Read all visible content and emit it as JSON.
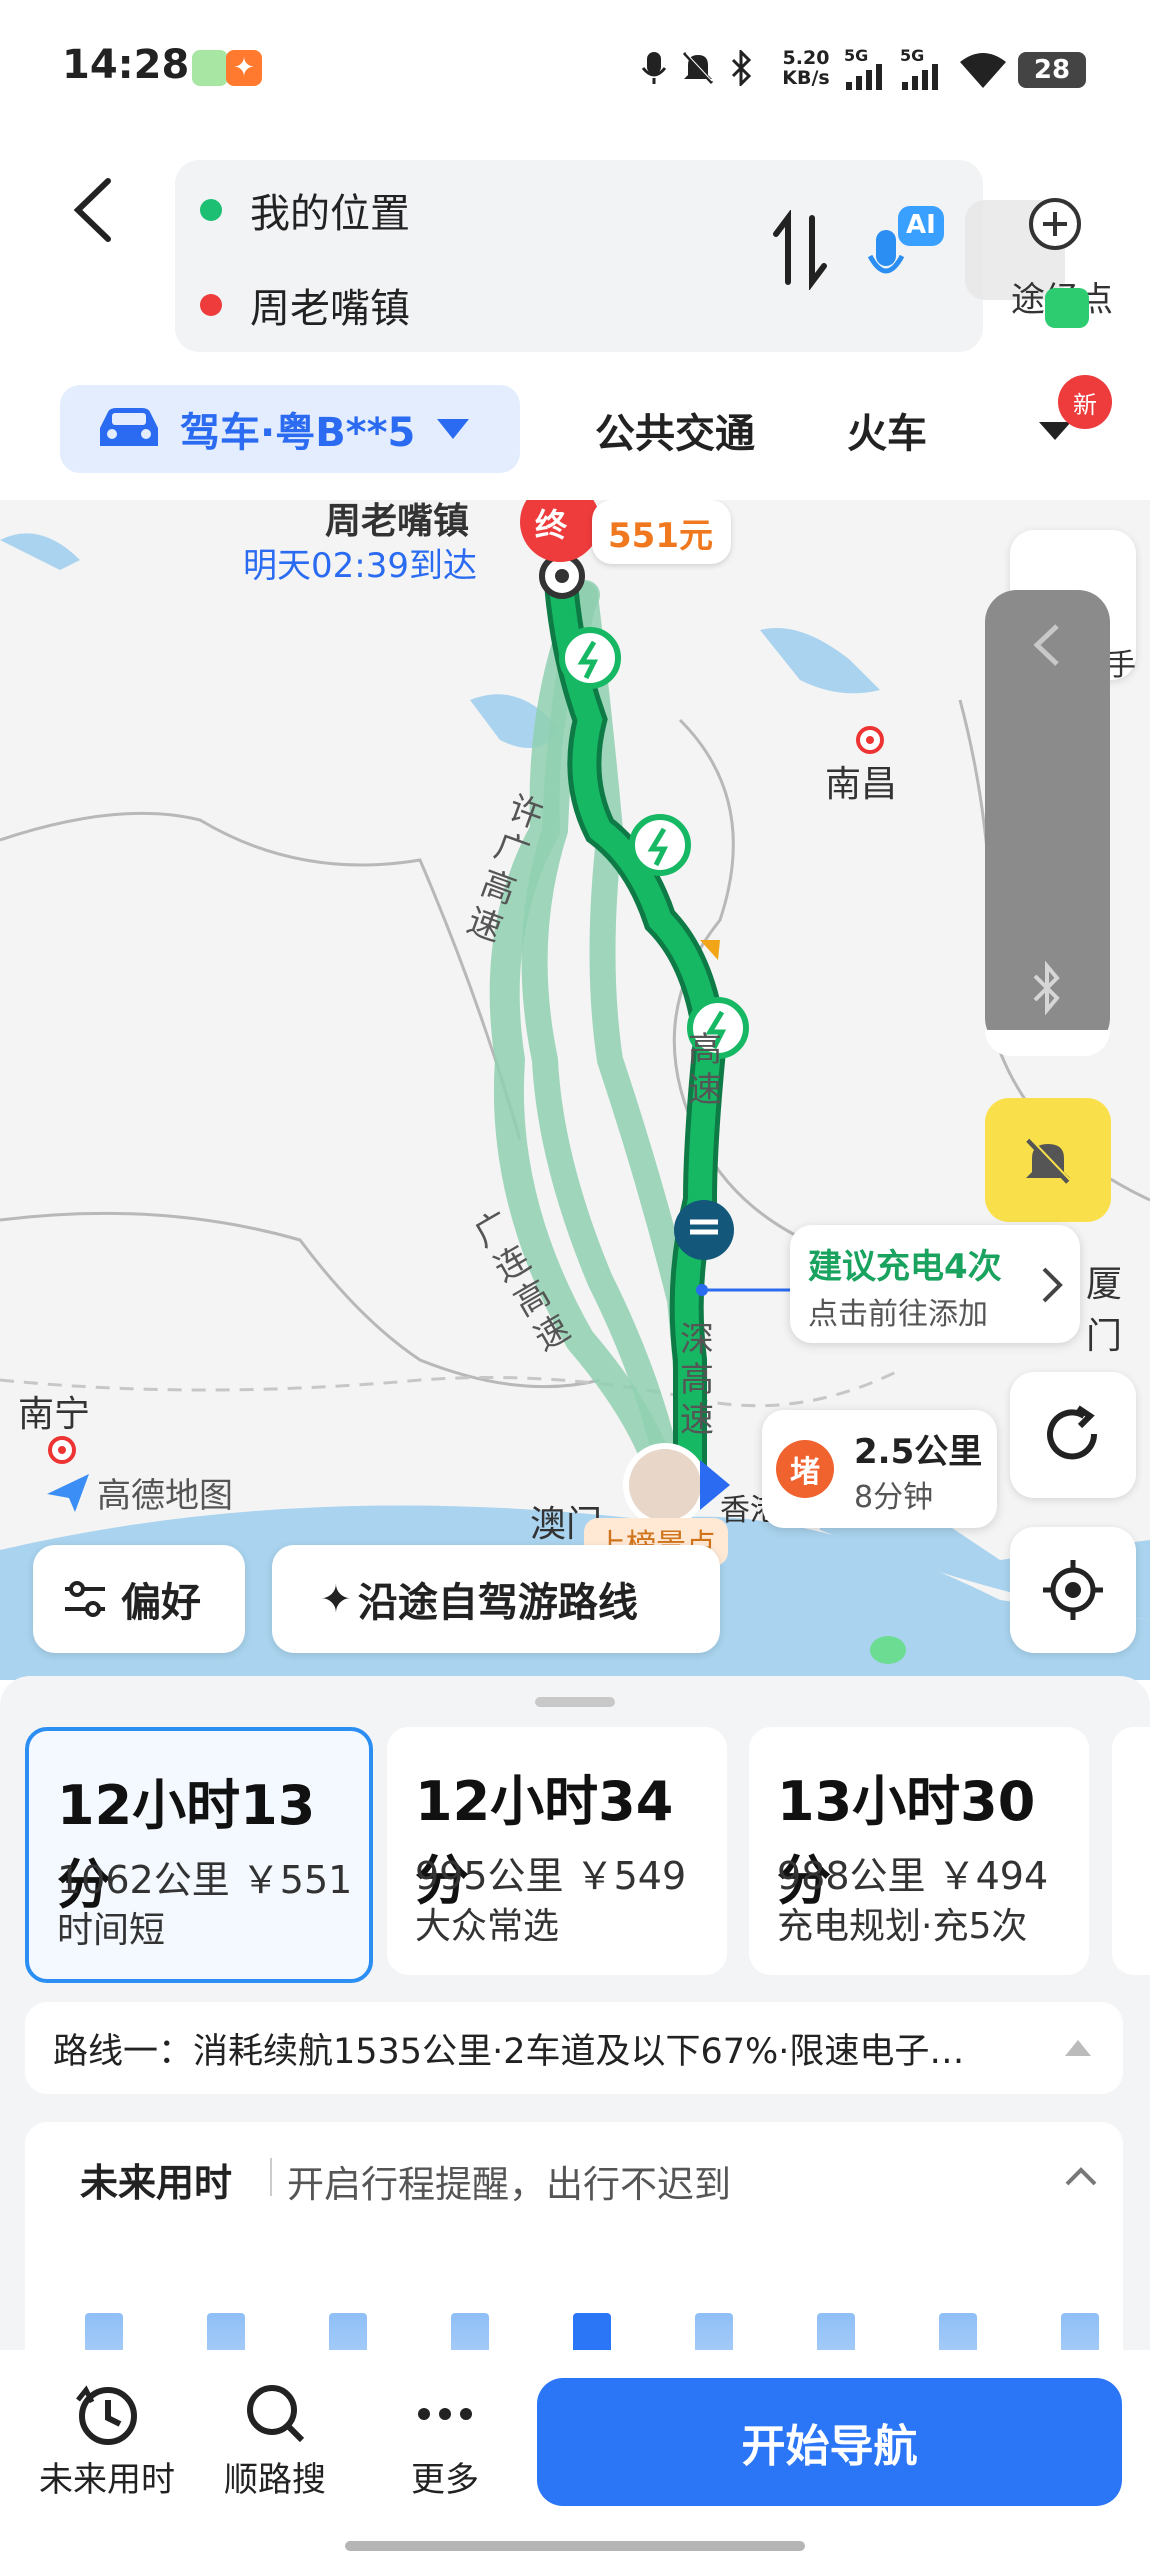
{
  "status_bar": {
    "time": "14:28",
    "net_speed_value": "5.20",
    "net_speed_unit": "KB/s",
    "signal1_label": "5G",
    "signal2_label": "5G",
    "battery": "28"
  },
  "header": {
    "origin": "我的位置",
    "destination": "周老嘴镇",
    "ai_label": "AI",
    "waypoint_label": "途经点",
    "colors": {
      "origin": "#1dbf73",
      "destination": "#ee3b3b"
    }
  },
  "tabs": {
    "car": "驾车·粤B**5",
    "transit": "公共交通",
    "train": "火车",
    "new_badge": "新"
  },
  "map": {
    "dest_name": "周老嘴镇",
    "arrive_text": "明天02:39到达",
    "toll_text": "551元",
    "dest_marker": "终",
    "city_nanchang": "南昌",
    "city_nanning": "南宁",
    "city_xiamen": "厦门",
    "city_macau": "澳门",
    "city_hk": "香港",
    "road_xuguang": "许广高速",
    "road_guanglian": "广连高速",
    "road_guangshen": "深高速",
    "road_upper": "高速",
    "logo_text": "高德地图",
    "hotspot": "上榜景点",
    "charge_title": "建议充电4次",
    "charge_sub": "点击前往添加",
    "jam_badge": "堵",
    "jam_dist": "2.5公里",
    "jam_time": "8分钟",
    "pref_label": "偏好",
    "self_drive_label": "沿途自驾游路线",
    "partial_hand_label": "手",
    "colors": {
      "route_main": "#10a85c",
      "route_alt": "#8fd0b0",
      "accent": "#2a6bf2"
    }
  },
  "routes": [
    {
      "time": "12小时13分",
      "dist": "1062公里 ￥551",
      "tag": "时间短",
      "selected": true
    },
    {
      "time": "12小时34分",
      "dist": "995公里 ￥549",
      "tag": "大众常选",
      "selected": false
    },
    {
      "time": "13小时30分",
      "dist": "988公里 ￥494",
      "tag": "充电规划·充5次",
      "selected": false
    }
  ],
  "route_info": "路线一：消耗续航1535公里·2车道及以下67%·限速电子…",
  "future": {
    "title": "未来用时",
    "subtitle": "开启行程提醒，出行不迟到",
    "bars": [
      0.55,
      0.55,
      0.55,
      0.55,
      0.55,
      0.55,
      0.55,
      0.55,
      0.55
    ],
    "highlight_index": 4
  },
  "bottom_nav": {
    "future_time": "未来用时",
    "search_along": "顺路搜",
    "more": "更多",
    "start": "开始导航"
  }
}
